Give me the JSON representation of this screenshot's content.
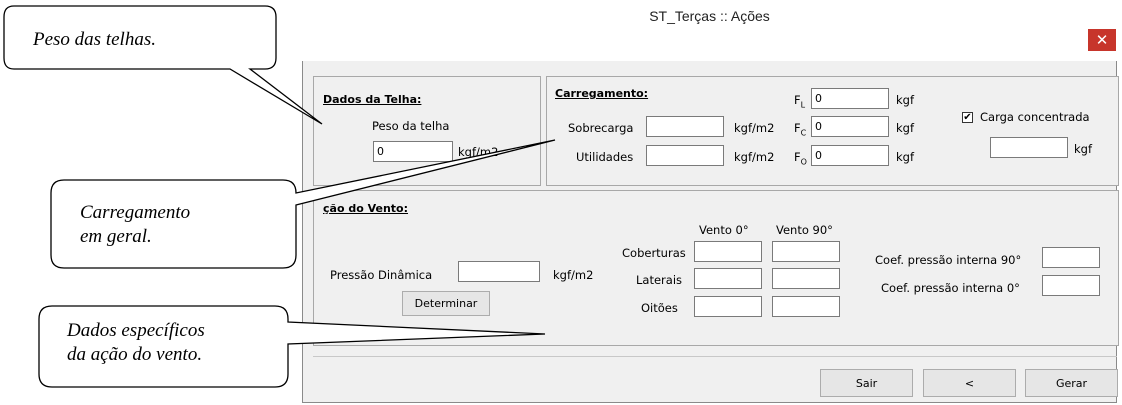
{
  "window": {
    "title": "ST_Terças :: Ações",
    "close_glyph": "✕"
  },
  "callouts": [
    {
      "lines": [
        "Peso das telhas."
      ]
    },
    {
      "lines": [
        "Carregamento",
        "em geral."
      ]
    },
    {
      "lines": [
        "Dados específicos",
        "da ação do vento."
      ]
    }
  ],
  "dados_telha": {
    "title": "Dados da Telha:",
    "peso_label": "Peso da telha",
    "peso_value": "0",
    "unit": "kgf/m2"
  },
  "carregamento": {
    "title": "Carregamento:",
    "sobrecarga_label": "Sobrecarga",
    "utilidades_label": "Utilidades",
    "unit_m2": "kgf/m2",
    "fl": {
      "letter": "F",
      "sub": "L",
      "value": "0",
      "unit": "kgf"
    },
    "fc": {
      "letter": "F",
      "sub": "C",
      "value": "0",
      "unit": "kgf"
    },
    "fo": {
      "letter": "F",
      "sub": "O",
      "value": "0",
      "unit": "kgf"
    },
    "carga_concentrada": {
      "label": "Carga concentrada",
      "checked_glyph": "✔",
      "unit": "kgf"
    }
  },
  "vento": {
    "title": "Ação do Vento:",
    "title_visible": "ção do Vento:",
    "pressao_label": "Pressão Dinâmica",
    "pressao_unit": "kgf/m2",
    "determinar": "Determinar",
    "col_0": "Vento 0°",
    "col_90": "Vento 90°",
    "coberturas": "Coberturas",
    "laterais": "Laterais",
    "oitoes": "Oitões",
    "coef_90": "Coef. pressão interna 90°",
    "coef_0": "Coef. pressão interna 0°"
  },
  "footer": {
    "sair": "Sair",
    "back": "<",
    "gerar": "Gerar"
  }
}
